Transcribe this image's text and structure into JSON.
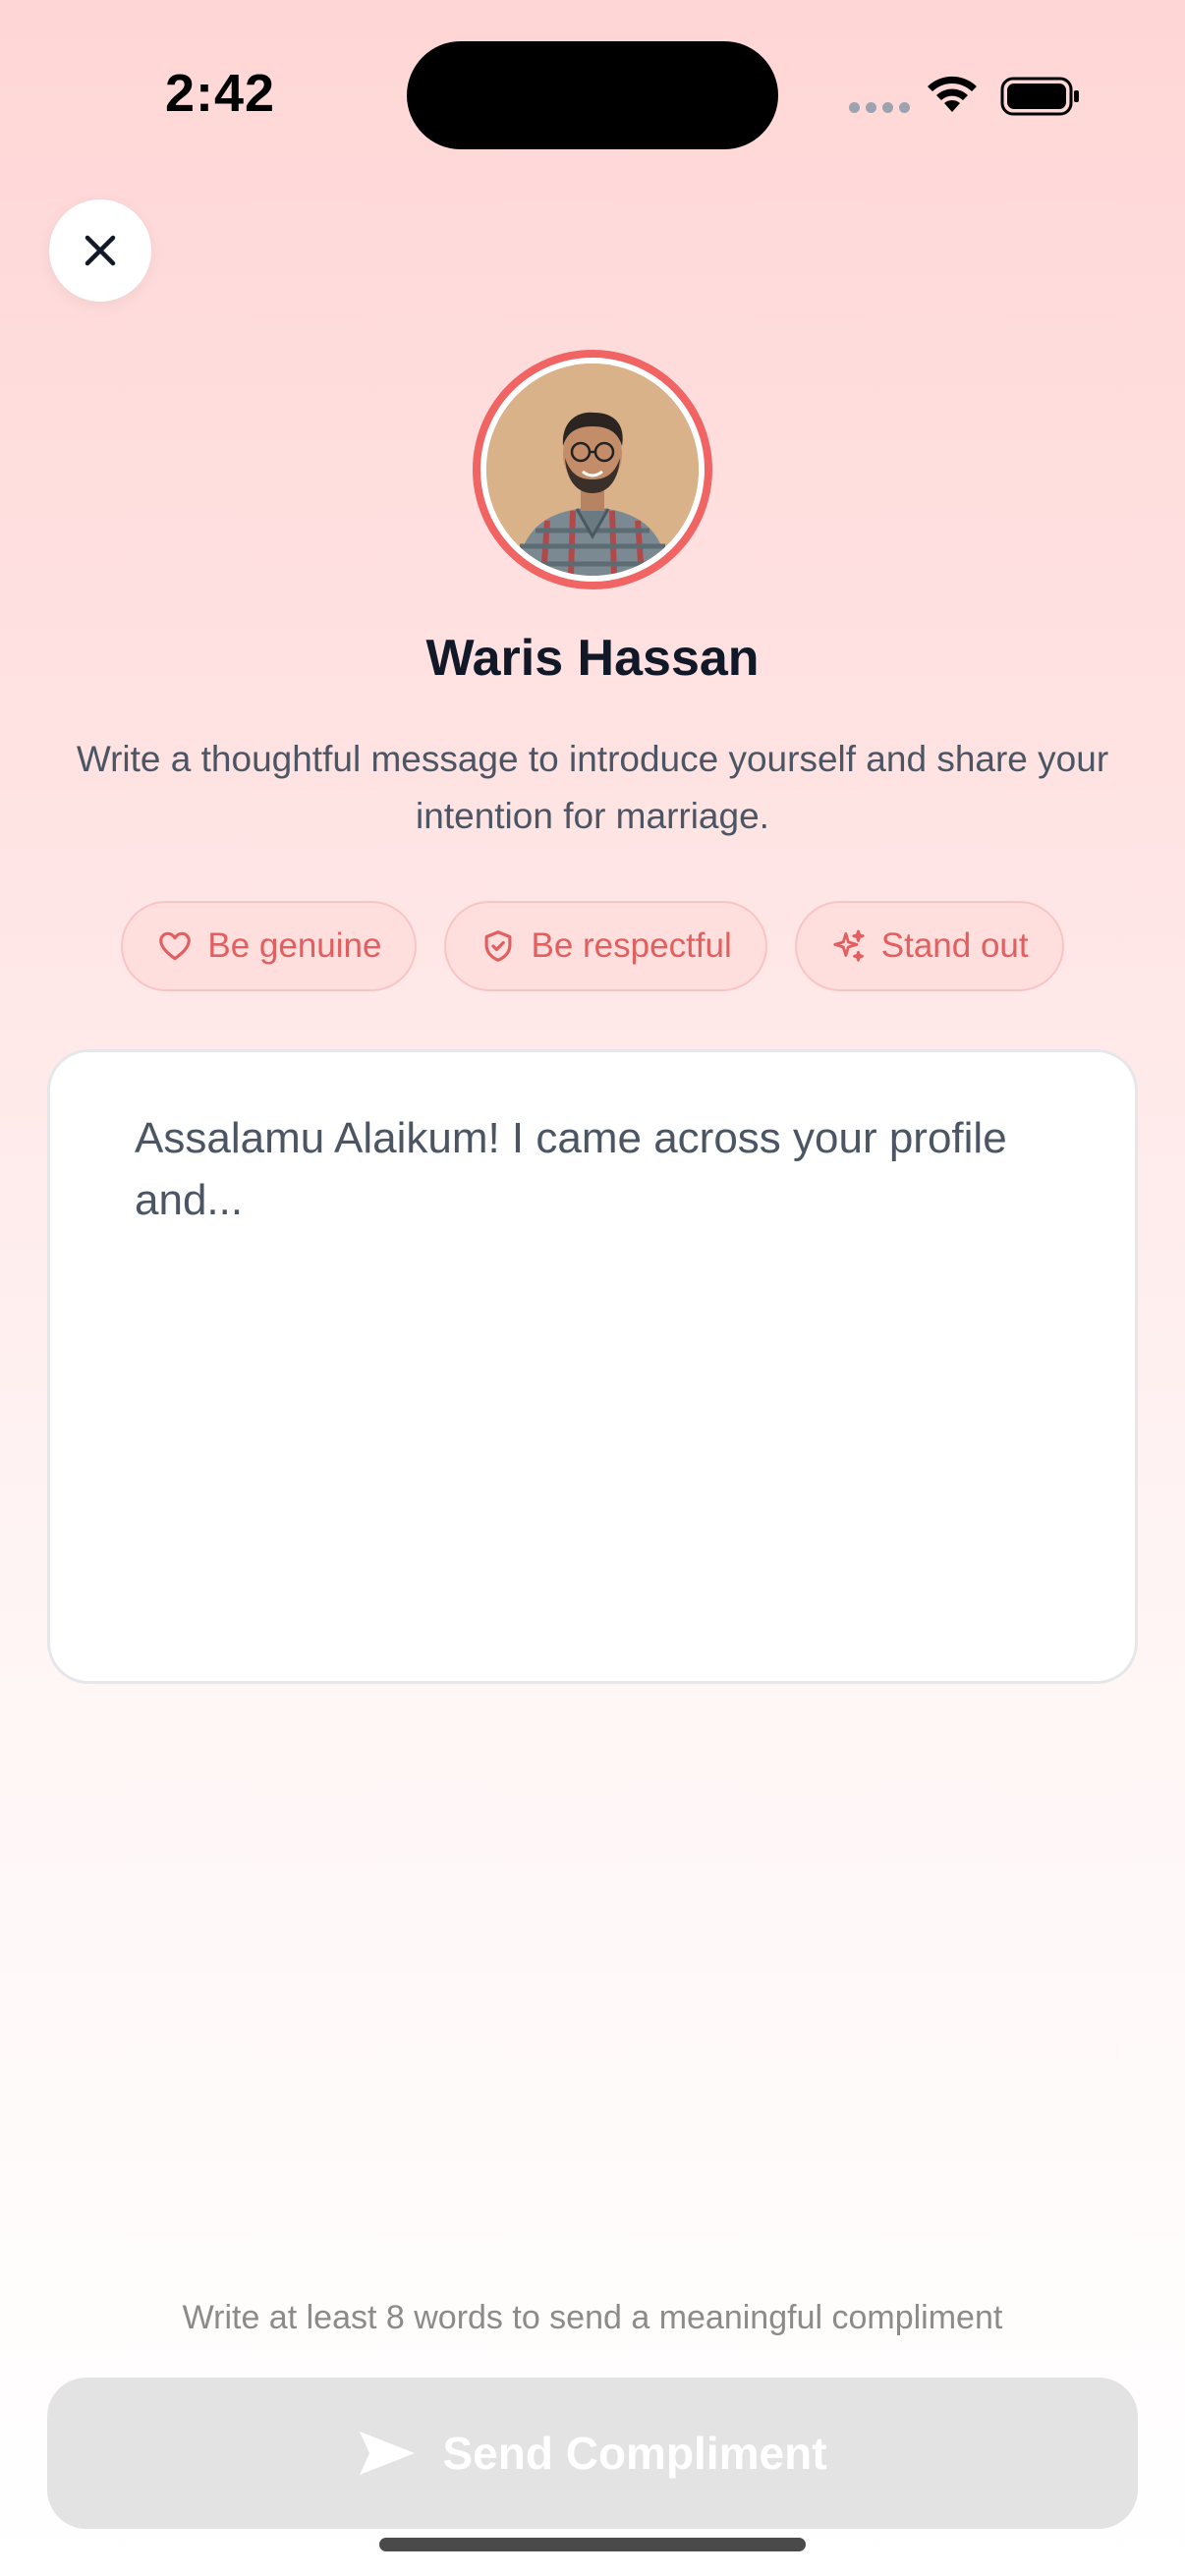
{
  "status_bar": {
    "time": "2:42"
  },
  "close_button": {
    "icon": "close-icon"
  },
  "profile": {
    "name": "Waris Hassan"
  },
  "intro": {
    "text": "Write a thoughtful message to introduce yourself and share your intention for marriage."
  },
  "chips": [
    {
      "label": "Be genuine",
      "icon": "heart-icon"
    },
    {
      "label": "Be respectful",
      "icon": "shield-check-icon"
    },
    {
      "label": "Stand out",
      "icon": "sparkles-icon"
    }
  ],
  "message": {
    "placeholder": "Assalamu Alaikum! I came across your profile and...",
    "value": ""
  },
  "hint": {
    "text": "Write at least 8 words to send a meaningful compliment"
  },
  "send_button": {
    "label": "Send Compliment",
    "icon": "send-icon"
  },
  "colors": {
    "accent": "#f06464",
    "chip_bg": "#ffdede",
    "disabled_button": "#e3e3e3"
  }
}
